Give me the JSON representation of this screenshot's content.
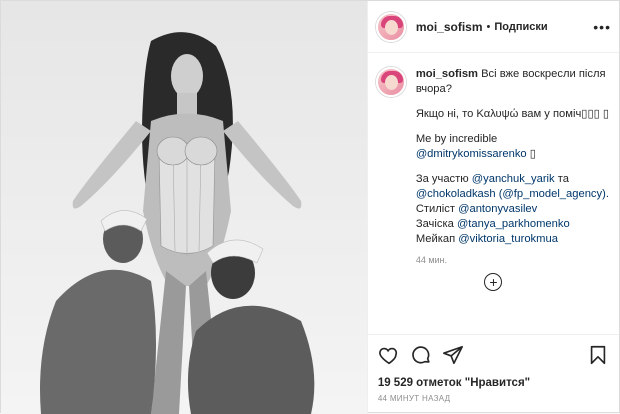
{
  "post": {
    "username": "moi_sofism",
    "separator": "•",
    "follow_label": "Подписки",
    "more_label": "•••"
  },
  "caption": {
    "username": "moi_sofism",
    "line1": "Всі вже воскресли після вчора?",
    "line2": "Якщо ні, то Καλυψώ вам у поміч▯▯▯ ▯",
    "line3_prefix": "Me by incredible",
    "line3_mention": "@dmitrykomissarenko",
    "line3_suffix": "▯",
    "credits_prefix": "За участю",
    "credits_m1": "@yanchuk_yarik",
    "credits_and": "та",
    "credits_m2": "@chokoladkash",
    "credits_m3": "(@fp_model_agency).",
    "stylist_prefix": "Стиліст",
    "stylist_mention": "@antonyvasilev",
    "hair_prefix": "Зачіска",
    "hair_mention": "@tanya_parkhomenko",
    "makeup_prefix": "Мейкап",
    "makeup_mention": "@viktoria_turokmua",
    "time": "44 мин."
  },
  "load_more": "+",
  "likes": "19 529 отметок \"Нравится\"",
  "date": "44 МИНУТ НАЗАД",
  "icons": {
    "like": "heart-icon",
    "comment": "comment-icon",
    "share": "share-icon",
    "save": "bookmark-icon"
  },
  "colors": {
    "text": "#262626",
    "mention": "#00376b",
    "muted": "#8e8e8e",
    "border": "#dbdbdb"
  }
}
